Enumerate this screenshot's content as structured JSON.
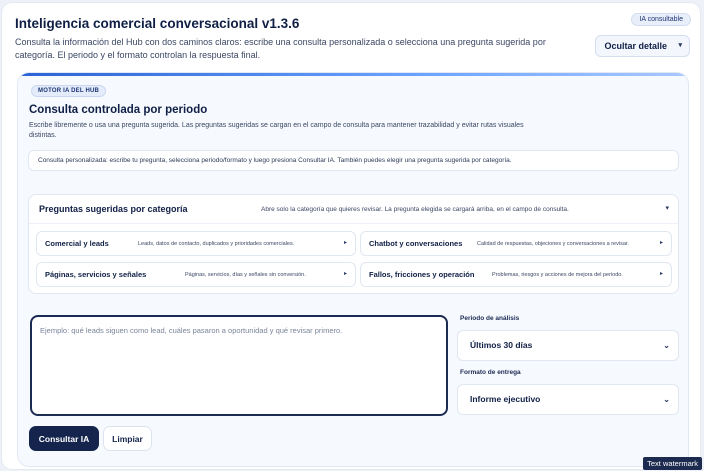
{
  "header": {
    "title": "Inteligencia comercial conversacional v1.3.6",
    "description": "Consulta la información del Hub con dos caminos claros: escribe una consulta personalizada o selecciona una pregunta sugerida por categoría. El periodo y el formato controlan la respuesta final.",
    "mode_badge": "IA consultable",
    "toggle_detail_label": "Ocultar detalle",
    "toggle_icon": "chevron-down-icon"
  },
  "panel": {
    "badge": "MOTOR IA DEL HUB",
    "title": "Consulta controlada por periodo",
    "description": "Escribe libremente o usa una pregunta sugerida. Las preguntas sugeridas se cargan en el campo de consulta para mantener trazabilidad y evitar rutas visuales distintas.",
    "hint": "Consulta personalizada: escribe tu pregunta, selecciona periodo/formato y luego presiona Consultar IA. También puedes elegir una pregunta sugerida por categoría."
  },
  "suggested": {
    "title": "Preguntas sugeridas por categoría",
    "subtitle": "Abre solo la categoría que quieres revisar. La pregunta elegida se cargará arriba, en el campo de consulta.",
    "categories": [
      {
        "name": "Comercial y leads",
        "description": "Leads, datos de contacto, duplicados y prioridades comerciales."
      },
      {
        "name": "Chatbot y conversaciones",
        "description": "Calidad de respuestas, objeciones y conversaciones a revisar."
      },
      {
        "name": "Páginas, servicios y señales",
        "description": "Páginas, servicios, días y señales sin conversión."
      },
      {
        "name": "Fallos, fricciones y operación",
        "description": "Problemas, riesgos y acciones de mejora del periodo."
      }
    ]
  },
  "query": {
    "placeholder": "Ejemplo: qué leads siguen como lead, cuáles pasaron a oportunidad y qué revisar primero.",
    "value": ""
  },
  "options": {
    "period_label": "Periodo de análisis",
    "period_value": "Últimos 30 días",
    "format_label": "Formato de entrega",
    "format_value": "Informe ejecutivo"
  },
  "actions": {
    "submit": "Consultar IA",
    "clear": "Limpiar"
  },
  "watermark": "Text watermark",
  "colors": {
    "primary": "#14244d",
    "accent": "#2a63d6",
    "panel_bg": "#f6f9fe"
  }
}
